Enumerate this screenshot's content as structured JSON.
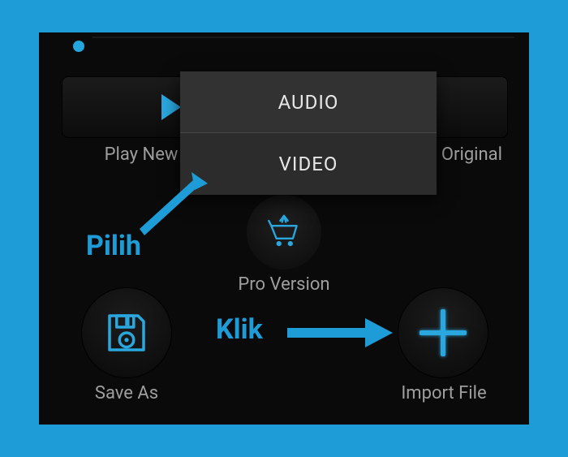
{
  "buttons": {
    "play_new": "Play New",
    "play_original": "Play Original",
    "pro": "Pro Version",
    "save_as": "Save As",
    "import_file": "Import File"
  },
  "popup": {
    "items": [
      "AUDIO",
      "VIDEO"
    ]
  },
  "annotations": {
    "pilih": "Pilih",
    "klik": "Klik"
  },
  "colors": {
    "accent": "#1d9cd8"
  }
}
